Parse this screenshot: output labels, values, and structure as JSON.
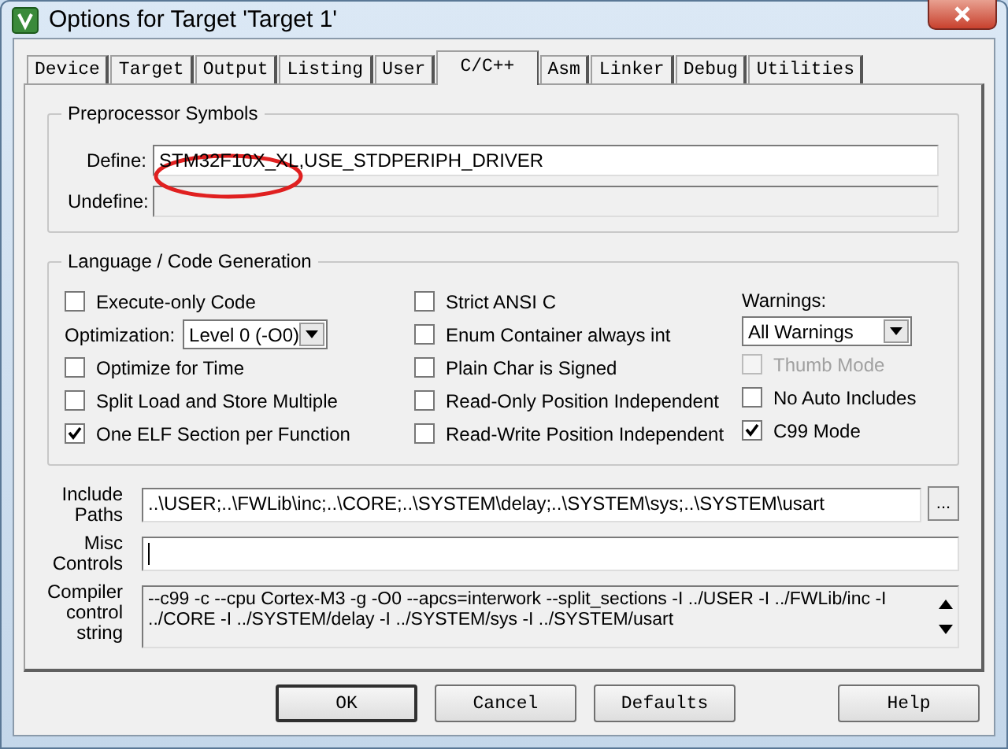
{
  "window": {
    "title": "Options for Target 'Target 1'"
  },
  "tabs": [
    {
      "label": "Device",
      "selected": false
    },
    {
      "label": "Target",
      "selected": false
    },
    {
      "label": "Output",
      "selected": false
    },
    {
      "label": "Listing",
      "selected": false
    },
    {
      "label": "User",
      "selected": false
    },
    {
      "label": "C/C++",
      "selected": true
    },
    {
      "label": "Asm",
      "selected": false
    },
    {
      "label": "Linker",
      "selected": false
    },
    {
      "label": "Debug",
      "selected": false
    },
    {
      "label": "Utilities",
      "selected": false
    }
  ],
  "preprocessor": {
    "title": "Preprocessor Symbols",
    "fields": [
      {
        "label": "Define:",
        "value": "STM32F10X_XL,USE_STDPERIPH_DRIVER",
        "disabled": false
      },
      {
        "label": "Undefine:",
        "disabled": true
      }
    ]
  },
  "language": {
    "title": "Language / Code Generation",
    "columns": [
      [
        {
          "kind": "checkbox",
          "label": "Execute-only Code",
          "checked": false,
          "disabled": false
        },
        {
          "kind": "select",
          "label": "Optimization:",
          "value": "Level 0 (-O0)"
        },
        {
          "kind": "checkbox",
          "label": "Optimize for Time",
          "checked": false,
          "disabled": false
        },
        {
          "kind": "checkbox",
          "label": "Split Load and Store Multiple",
          "checked": false,
          "disabled": false
        },
        {
          "kind": "checkbox",
          "label": "One ELF Section per Function",
          "checked": true,
          "disabled": false
        }
      ],
      [
        {
          "kind": "checkbox",
          "label": "Strict ANSI C",
          "checked": false,
          "disabled": false
        },
        {
          "kind": "checkbox",
          "label": "Enum Container always int",
          "checked": false,
          "disabled": false
        },
        {
          "kind": "checkbox",
          "label": "Plain Char is Signed",
          "checked": false,
          "disabled": false
        },
        {
          "kind": "checkbox",
          "label": "Read-Only Position Independent",
          "checked": false,
          "disabled": false
        },
        {
          "kind": "checkbox",
          "label": "Read-Write Position Independent",
          "checked": false,
          "disabled": false
        }
      ],
      [
        {
          "kind": "heading",
          "label": "Warnings:"
        },
        {
          "kind": "select",
          "value": "All Warnings"
        },
        {
          "kind": "checkbox",
          "label": "Thumb Mode",
          "checked": false,
          "disabled": true
        },
        {
          "kind": "checkbox",
          "label": "No Auto Includes",
          "checked": false,
          "disabled": false
        },
        {
          "kind": "checkbox",
          "label": "C99 Mode",
          "checked": true,
          "disabled": false
        }
      ]
    ]
  },
  "paths": [
    {
      "kind": "browse",
      "label": "Include Paths",
      "value": "..\\USER;..\\FWLib\\inc;..\\CORE;..\\SYSTEM\\delay;..\\SYSTEM\\sys;..\\SYSTEM\\usart",
      "button": "..."
    },
    {
      "kind": "input",
      "label": "Misc Controls"
    },
    {
      "kind": "readonly",
      "label": "Compiler control string",
      "value": "--c99 -c --cpu Cortex-M3 -g -O0 --apcs=interwork --split_sections -I ../USER -I ../FWLib/inc -I ../CORE -I ../SYSTEM/delay -I ../SYSTEM/sys -I ../SYSTEM/usart"
    }
  ],
  "buttons": [
    {
      "label": "OK",
      "default": true
    },
    {
      "label": "Cancel",
      "default": false
    },
    {
      "label": "Defaults",
      "default": false
    },
    {
      "label": "Help",
      "default": false
    }
  ]
}
